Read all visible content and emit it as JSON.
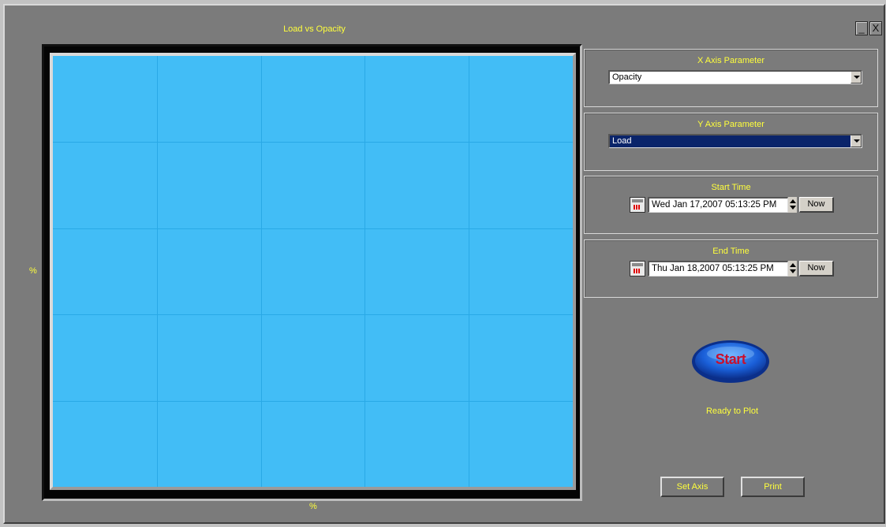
{
  "window": {
    "minimize_label": "_",
    "close_label": "X"
  },
  "chart": {
    "title": "Load vs Opacity",
    "ylabel": "%",
    "xlabel": "%"
  },
  "chart_data": {
    "type": "scatter",
    "title": "Load vs Opacity",
    "xlabel": "%",
    "ylabel": "%",
    "series": [],
    "grid": true,
    "grid_divisions": {
      "x": 5,
      "y": 5
    },
    "plot_background": "#42bdf6"
  },
  "x_axis_group": {
    "title": "X Axis Parameter",
    "selected": "Opacity"
  },
  "y_axis_group": {
    "title": "Y Axis Parameter",
    "selected": "Load"
  },
  "start_time": {
    "title": "Start Time",
    "value": "Wed Jan 17,2007  05:13:25 PM",
    "now_label": "Now"
  },
  "end_time": {
    "title": "End Time",
    "value": "Thu  Jan 18,2007  05:13:25 PM",
    "now_label": "Now"
  },
  "start_button": {
    "label": "Start"
  },
  "status_text": "Ready to Plot",
  "buttons": {
    "set_axis": "Set Axis",
    "print": "Print"
  },
  "colors": {
    "accent_text": "#ffff3c",
    "panel": "#7b7b7b",
    "plot_bg": "#42bdf6",
    "grid": "#29a9e6",
    "selection": "#0a246a",
    "start_text": "#c8102e"
  }
}
